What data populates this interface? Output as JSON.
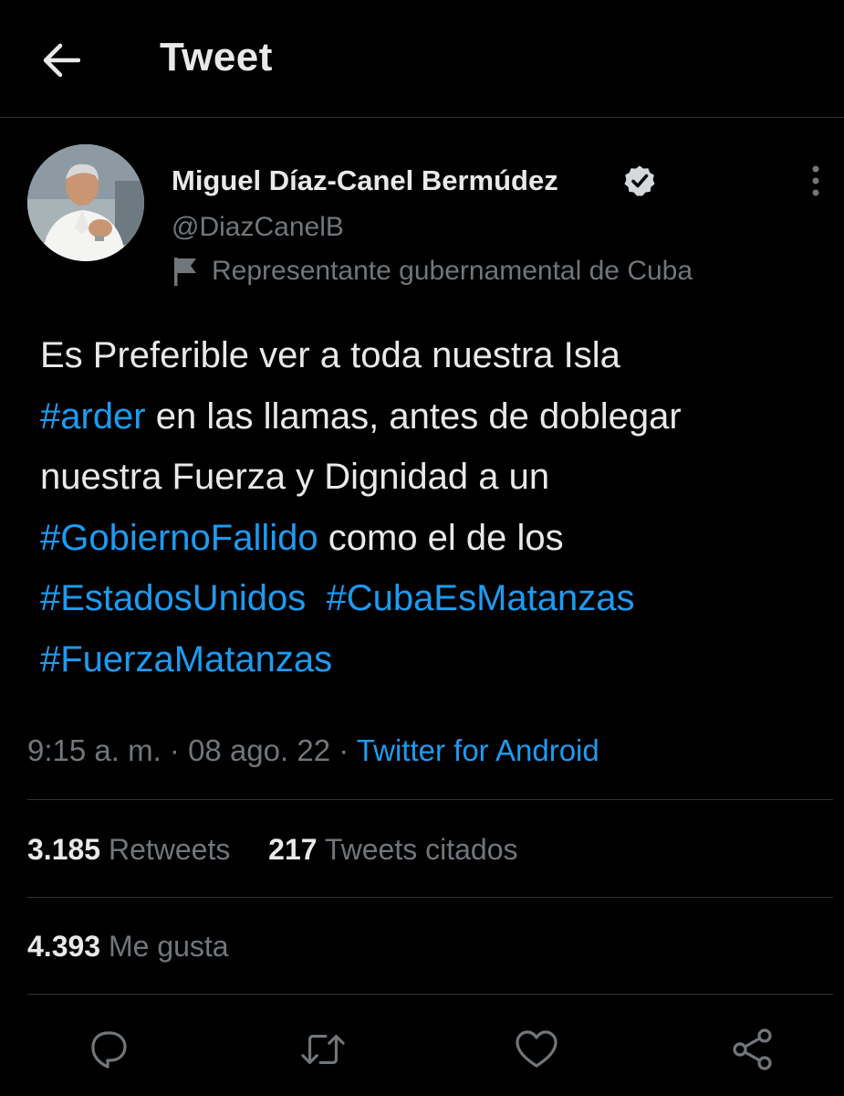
{
  "header": {
    "back_icon": "arrow-left-icon",
    "title": "Tweet"
  },
  "author": {
    "name": "Miguel Díaz-Canel Bermúdez",
    "handle": "@DiazCanelB",
    "verified": true,
    "label": "Representante gubernamental de Cuba",
    "label_icon": "flag-icon",
    "more_icon": "more-vertical-icon"
  },
  "tweet": {
    "lines": [
      [
        {
          "text": "Es Preferible ver a toda nuestra Isla",
          "tag": false
        }
      ],
      [
        {
          "text": "#arder",
          "tag": true
        },
        {
          "text": " en las llamas, antes de doblegar",
          "tag": false
        }
      ],
      [
        {
          "text": "nuestra Fuerza y Dignidad a un",
          "tag": false
        }
      ],
      [
        {
          "text": "#GobiernoFallido",
          "tag": true
        },
        {
          "text": " como el de los",
          "tag": false
        }
      ],
      [
        {
          "text": "#EstadosUnidos",
          "tag": true
        },
        {
          "text": "  ",
          "tag": false
        },
        {
          "text": "#CubaEsMatanzas",
          "tag": true
        }
      ],
      [
        {
          "text": "#FuerzaMatanzas",
          "tag": true
        }
      ]
    ]
  },
  "meta": {
    "time": "9:15 a. m.",
    "separator": " · ",
    "date": "08 ago. 22",
    "source": "Twitter for Android"
  },
  "stats": {
    "retweets_count": "3.185",
    "retweets_label": "Retweets",
    "quotes_count": "217",
    "quotes_label": "Tweets citados",
    "likes_count": "4.393",
    "likes_label": "Me gusta"
  },
  "actions": {
    "reply_icon": "reply-icon",
    "retweet_icon": "retweet-icon",
    "like_icon": "heart-icon",
    "share_icon": "share-icon"
  },
  "colors": {
    "background": "#000000",
    "text": "#e7e9ea",
    "secondary": "#71767b",
    "accent": "#1d9bf0",
    "divider": "#2f3336"
  }
}
